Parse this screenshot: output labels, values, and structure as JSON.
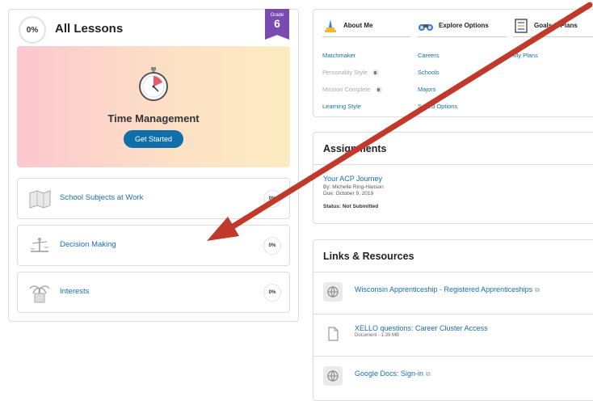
{
  "lessons": {
    "progress": "0%",
    "title": "All Lessons",
    "grade_label": "Grade",
    "grade_number": "6",
    "hero_title": "Time Management",
    "hero_button": "Get Started",
    "items": [
      {
        "label": "School Subjects at Work",
        "progress": "0%"
      },
      {
        "label": "Decision Making",
        "progress": "0%"
      },
      {
        "label": "Interests",
        "progress": "0%"
      }
    ]
  },
  "nav": {
    "columns": [
      {
        "heading": "About Me",
        "links": [
          {
            "label": "Matchmaker",
            "locked": false
          },
          {
            "label": "Personality Style",
            "locked": true
          },
          {
            "label": "Mission Complete",
            "locked": true
          },
          {
            "label": "Learning Style",
            "locked": false
          }
        ]
      },
      {
        "heading": "Explore Options",
        "links": [
          {
            "label": "Careers",
            "locked": false
          },
          {
            "label": "Schools",
            "locked": false
          },
          {
            "label": "Majors",
            "locked": false
          },
          {
            "label": "Saved Options",
            "locked": false
          }
        ]
      },
      {
        "heading": "Goals & Plans",
        "links": [
          {
            "label": "My Plans",
            "locked": false
          }
        ]
      }
    ]
  },
  "assignments": {
    "heading": "Assignments",
    "item_title": "Your ACP Journey",
    "by": "By: Michelle Ring-Hanson",
    "due": "Due: October 9, 2019",
    "status": "Status: Not Submitted"
  },
  "links": {
    "heading": "Links & Resources",
    "items": [
      {
        "title": "Wisconsin Apprenticeship - Registered Apprenticeships",
        "sub": "",
        "icon": "globe-icon"
      },
      {
        "title": "XELLO questions: Career Cluster Access",
        "sub": "Document - 1.39 MB",
        "icon": "document-icon"
      },
      {
        "title": "Google Docs: Sign-in",
        "sub": "",
        "icon": "globe-icon"
      }
    ]
  },
  "colors": {
    "accent": "#0f6fa8",
    "grade": "#7b4ab0",
    "arrow": "#c0392b",
    "link": "#1a6fa8"
  }
}
